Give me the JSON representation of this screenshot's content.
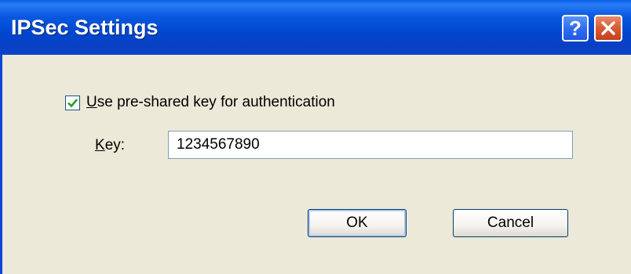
{
  "window": {
    "title": "IPSec Settings"
  },
  "titlebar_buttons": {
    "help_label": "?",
    "close_icon": "close-x-icon"
  },
  "form": {
    "checkbox": {
      "checked": true,
      "mnemonic": "U",
      "label_rest": "se pre-shared key for authentication"
    },
    "key": {
      "mnemonic": "K",
      "label_rest": "ey:",
      "value": "1234567890"
    }
  },
  "buttons": {
    "ok_label": "OK",
    "cancel_label": "Cancel"
  },
  "colors": {
    "titlebar": "#0047cf",
    "dialog_bg": "#ece9d8",
    "close_red": "#d85a35",
    "check_green": "#21a121"
  }
}
